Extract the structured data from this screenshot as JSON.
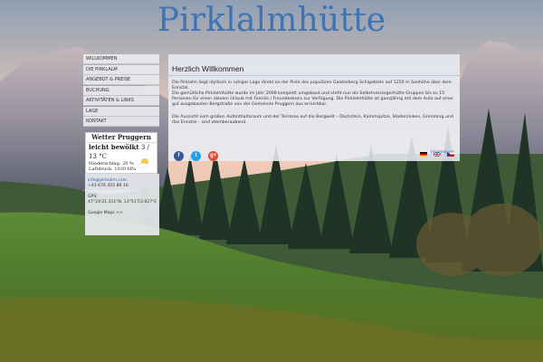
{
  "site": {
    "title": "Pirklalmhütte"
  },
  "menu": [
    "WILLKOMMEN",
    "DIE PIRKLALM",
    "ANGEBOT & PREISE",
    "BUCHUNG",
    "AKTIVITÄTEN & LINKS",
    "LAGE",
    "KONTAKT"
  ],
  "weather": {
    "title": "Wetter Pruggern",
    "condition": "leicht bewölkt",
    "temps": "3 / 13 °C",
    "precip": "Niederschlag: 20 %",
    "pressure": "Luftdruck: 1030 hPa",
    "icon": "partly-cloudy-sun-icon"
  },
  "contact": {
    "email": "info@pirklalm.com",
    "phone": "+43 676 455 89 16",
    "gps_label": "GPS:",
    "gps": "47°24'21.311\"N, 13°51'53.927\"E",
    "maps_link": "Google Maps >>"
  },
  "content": {
    "heading": "Herzlich Willkommen",
    "paragraphs": [
      "Die Pirklalm liegt idyllisch in ruhiger Lage direkt an der Piste des populären Galsterberg Schigebiets auf 1250 m Seehöhe über dem Ennstal.",
      "Die gemütliche Pirklalmhütte wurde im Jahr 2008 komplett umgebaut und steht nun als Selbstversorgerhütte Gruppen bis zu 15 Personen für einen idealen Urlaub mit Familie / Freundeskreis zur Verfügung. Die Pirklalmhütte ist ganzjährig mit dem Auto auf einer gut ausgebauten Bergstraße von der Gemeinde Pruggern aus erreichbar.",
      "Die Aussicht vom großen Aufenthaltsraum und der Terrasse auf die Bergwelt – Dachstein, Kammspitze, Stoderzinken, Grimming und das Ennstal – sind atemberaubend."
    ],
    "social": {
      "facebook": "f",
      "twitter": "t",
      "googleplus": "g+"
    },
    "impressum": "Impressum"
  }
}
